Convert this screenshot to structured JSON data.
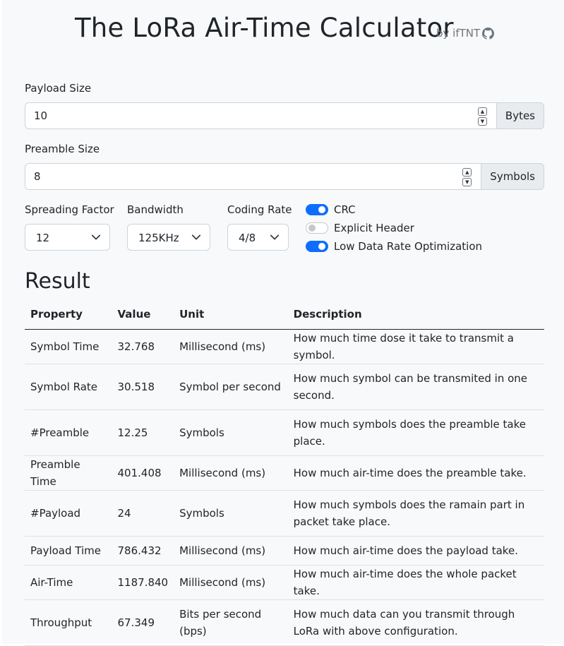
{
  "header": {
    "title": "The LoRa Air-Time Calculator",
    "byline": "by ifTNT",
    "icon": "github-icon"
  },
  "form": {
    "payload": {
      "label": "Payload Size",
      "value": "10",
      "unit": "Bytes"
    },
    "preamble": {
      "label": "Preamble Size",
      "value": "8",
      "unit": "Symbols"
    },
    "spreading_factor": {
      "label": "Spreading Factor",
      "value": "12"
    },
    "bandwidth": {
      "label": "Bandwidth",
      "value": "125KHz"
    },
    "coding_rate": {
      "label": "Coding Rate",
      "value": "4/8"
    },
    "toggles": [
      {
        "label": "CRC",
        "checked": true
      },
      {
        "label": "Explicit Header",
        "checked": false
      },
      {
        "label": "Low Data Rate Optimization",
        "checked": true
      }
    ],
    "accent_color": "#0d6efd"
  },
  "result": {
    "heading": "Result",
    "columns": [
      "Property",
      "Value",
      "Unit",
      "Description"
    ],
    "rows": [
      {
        "property": "Symbol Time",
        "value": "32.768",
        "unit": "Millisecond (ms)",
        "description": "How much time dose it take to transmit a symbol."
      },
      {
        "property": "Symbol Rate",
        "value": "30.518",
        "unit": "Symbol per second",
        "description": "How much symbol can be transmited in one second."
      },
      {
        "property": "#Preamble",
        "value": "12.25",
        "unit": "Symbols",
        "description": "How much symbols does the preamble take place."
      },
      {
        "property": "Preamble Time",
        "value": "401.408",
        "unit": "Millisecond (ms)",
        "description": "How much air-time does the preamble take."
      },
      {
        "property": "#Payload",
        "value": "24",
        "unit": "Symbols",
        "description": "How much symbols does the ramain part in packet take place."
      },
      {
        "property": "Payload Time",
        "value": "786.432",
        "unit": "Millisecond (ms)",
        "description": "How much air-time does the payload take."
      },
      {
        "property": "Air-Time",
        "value": "1187.840",
        "unit": "Millisecond (ms)",
        "description": "How much air-time does the whole packet take."
      },
      {
        "property": "Throughput",
        "value": "67.349",
        "unit": "Bits per second (bps)",
        "description": "How much data can you transmit through LoRa with above configuration."
      }
    ]
  }
}
